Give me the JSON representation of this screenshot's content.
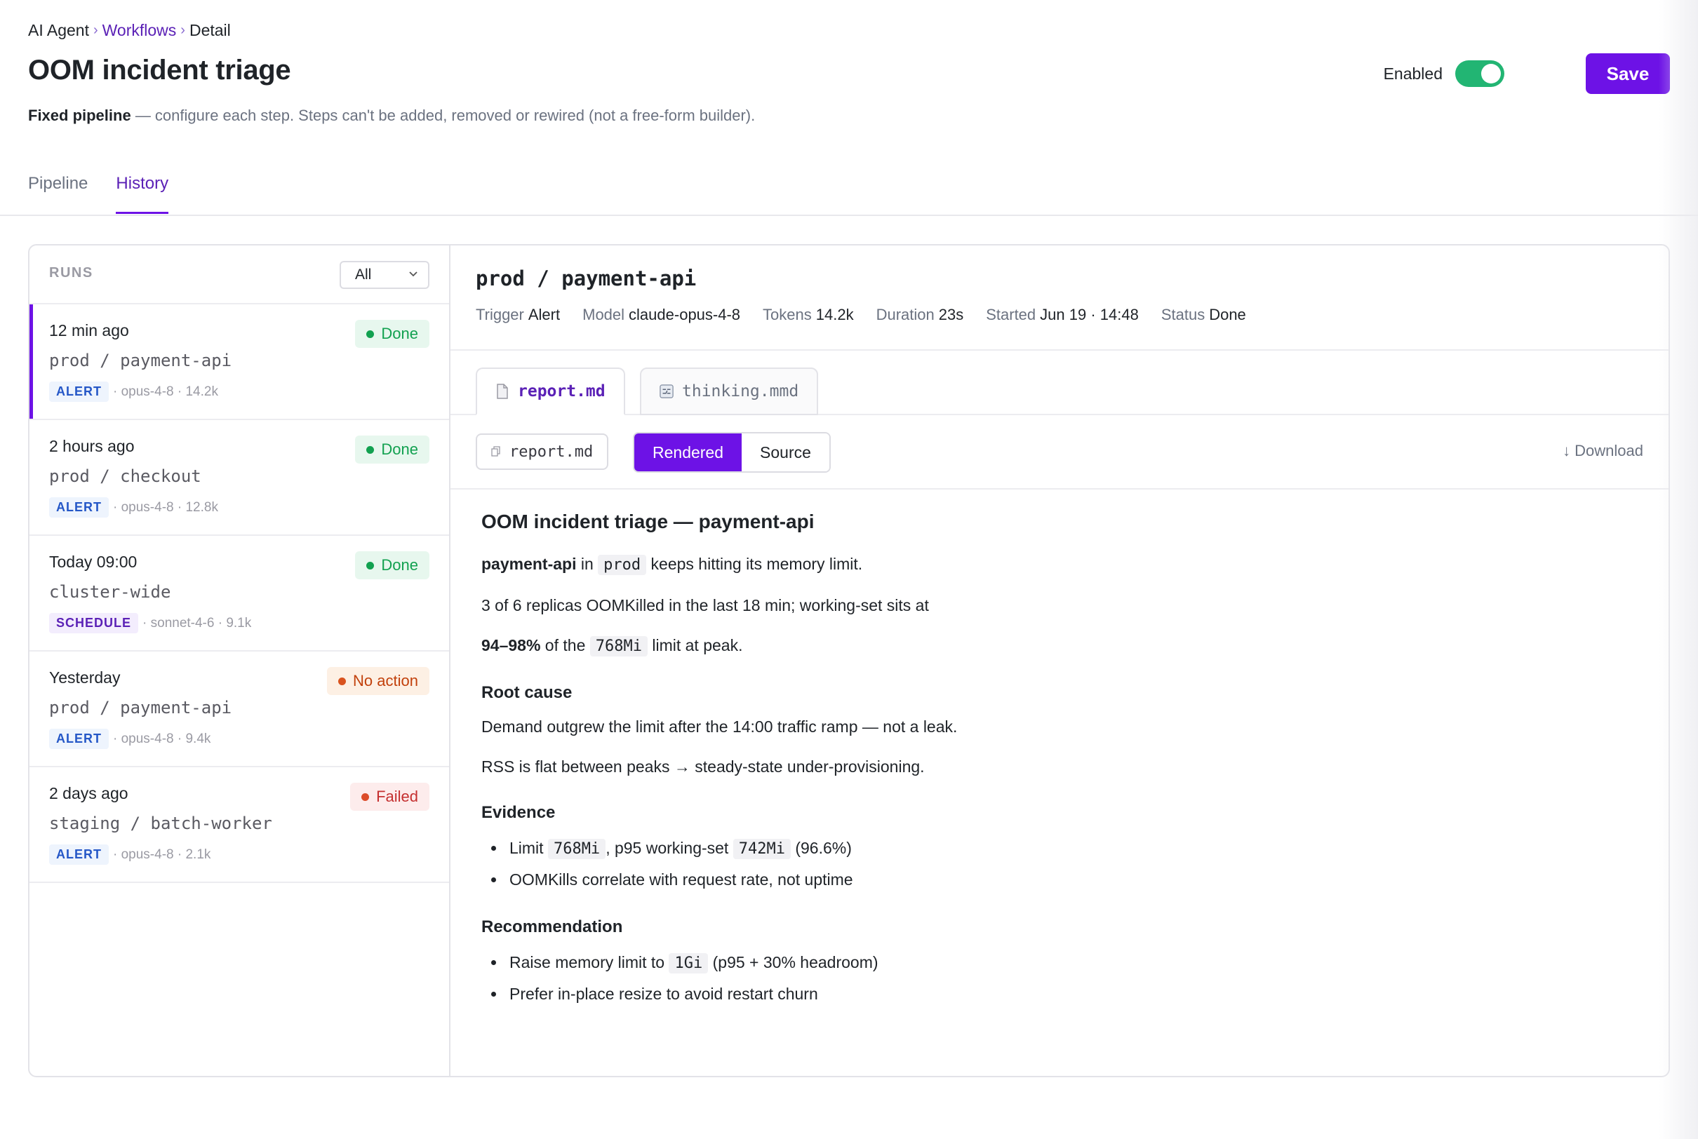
{
  "breadcrumb": {
    "root": "AI Agent",
    "section": "Workflows",
    "current": "Detail"
  },
  "title": "OOM incident triage",
  "subtitle": {
    "bold": "Fixed pipeline",
    "rest": " — configure each step. Steps can't be added, removed or rewired (not a free-form builder)."
  },
  "enabled": {
    "label": "Enabled",
    "on": true
  },
  "save_label": "Save",
  "tabs": [
    {
      "label": "Pipeline",
      "active": false
    },
    {
      "label": "History",
      "active": true
    }
  ],
  "runs": {
    "title": "RUNS",
    "filter": "All",
    "items": [
      {
        "time": "12 min ago",
        "target": "prod / payment-api",
        "tag": "ALERT",
        "meta": "· opus-4-8 · 14.2k",
        "status": "Done"
      },
      {
        "time": "2 hours ago",
        "target": "prod / checkout",
        "tag": "ALERT",
        "meta": "· opus-4-8 · 12.8k",
        "status": "Done"
      },
      {
        "time": "Today 09:00",
        "target": "cluster-wide",
        "tag": "SCHEDULE",
        "meta": "· sonnet-4-6 · 9.1k",
        "status": "Done"
      },
      {
        "time": "Yesterday",
        "target": "prod / payment-api",
        "tag": "ALERT",
        "meta": "· opus-4-8 · 9.4k",
        "status": "No action"
      },
      {
        "time": "2 days ago",
        "target": "staging / batch-worker",
        "tag": "ALERT",
        "meta": "· opus-4-8 · 2.1k",
        "status": "Failed"
      }
    ]
  },
  "detail": {
    "title": "prod / payment-api",
    "meta": {
      "trigger_k": "Trigger",
      "trigger_v": "Alert",
      "model_k": "Model",
      "model_v": "claude-opus-4-8",
      "tokens_k": "Tokens",
      "tokens_v": "14.2k",
      "duration_k": "Duration",
      "duration_v": "23s",
      "started_k": "Started",
      "started_v": "Jun 19 · 14:48",
      "status_k": "Status",
      "status_v": "Done"
    },
    "file_tabs": [
      "report.md",
      "thinking.mmd"
    ],
    "file_chip": "report.md",
    "view_modes": [
      "Rendered",
      "Source"
    ],
    "download": "Download"
  },
  "report": {
    "h1": "OOM incident triage — payment-api",
    "p1": {
      "bold": "payment-api",
      "t1": " in ",
      "code": "prod",
      "t2": " keeps hitting its memory limit."
    },
    "p2": "3 of 6 replicas OOMKilled in the last 18 min; working-set sits at",
    "p3": {
      "bold": "94–98%",
      "t1": " of the ",
      "code": "768Mi",
      "t2": " limit at peak."
    },
    "h_root": "Root cause",
    "root1": "Demand outgrew the limit after the 14:00 traffic ramp — not a leak.",
    "root2": "RSS is flat between peaks → steady-state under-provisioning.",
    "h_evidence": "Evidence",
    "ev1": {
      "t1": "Limit ",
      "code1": "768Mi",
      "t2": ", p95 working-set ",
      "code2": "742Mi",
      "t3": " (96.6%)"
    },
    "ev2": "OOMKills correlate with request rate, not uptime",
    "h_rec": "Recommendation",
    "rec1": {
      "t1": "Raise memory limit to ",
      "code": "1Gi",
      "t2": " (p95 + 30% headroom)"
    },
    "rec2": "Prefer in-place resize to avoid restart churn"
  },
  "colors": {
    "accent": "#6d12e6",
    "toggle_on": "#22b573",
    "done": "#12a150",
    "noaction": "#c2410c",
    "failed": "#c53030"
  }
}
